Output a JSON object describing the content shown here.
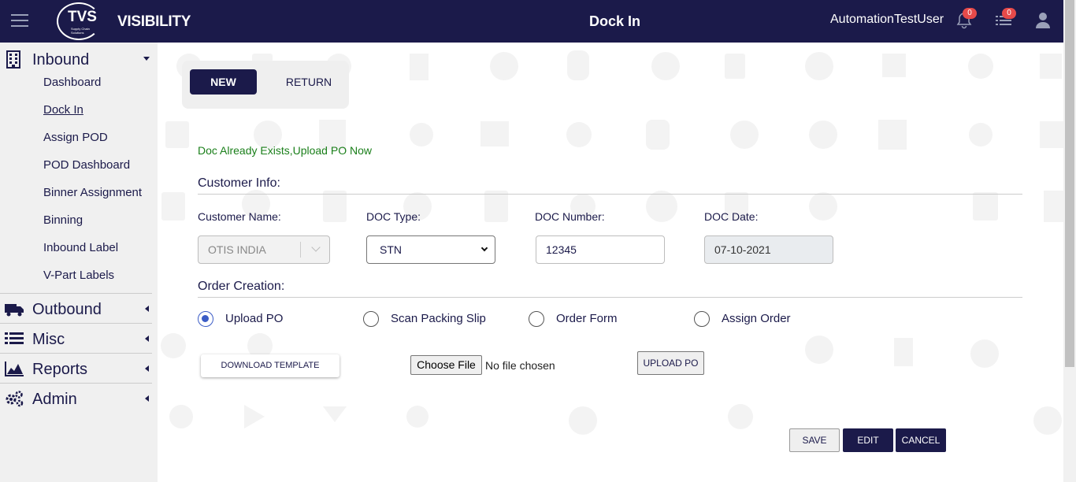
{
  "header": {
    "logo_text": "TVS",
    "logo_sub": "Supply Chain Solutions",
    "app_name": "VISIBILITY",
    "page_title": "Dock In",
    "username": "AutomationTestUser",
    "notifications_count": "0",
    "tasks_count": "0"
  },
  "sidebar": {
    "inbound": {
      "label": "Inbound",
      "items": [
        {
          "label": "Dashboard"
        },
        {
          "label": "Dock In"
        },
        {
          "label": "Assign POD"
        },
        {
          "label": "POD Dashboard"
        },
        {
          "label": "Binner Assignment"
        },
        {
          "label": "Binning"
        },
        {
          "label": "Inbound Label"
        },
        {
          "label": "V-Part Labels"
        }
      ]
    },
    "outbound": {
      "label": "Outbound"
    },
    "misc": {
      "label": "Misc"
    },
    "reports": {
      "label": "Reports"
    },
    "admin": {
      "label": "Admin"
    }
  },
  "main": {
    "toggle": {
      "new_label": "NEW",
      "return_label": "RETURN"
    },
    "message": "Doc Already Exists,Upload PO Now",
    "customer_info_title": "Customer Info:",
    "fields": {
      "customer_name": {
        "label": "Customer Name:",
        "value": "OTIS INDIA"
      },
      "doc_type": {
        "label": "DOC Type:",
        "value": "STN"
      },
      "doc_number": {
        "label": "DOC Number:",
        "value": "12345"
      },
      "doc_date": {
        "label": "DOC Date:",
        "value": "07-10-2021"
      }
    },
    "order_creation_title": "Order Creation:",
    "order_options": [
      {
        "label": "Upload PO",
        "checked": true
      },
      {
        "label": "Scan Packing Slip",
        "checked": false
      },
      {
        "label": "Order Form",
        "checked": false
      },
      {
        "label": "Assign Order",
        "checked": false
      }
    ],
    "download_template_label": "DOWNLOAD TEMPLATE",
    "choose_file_label": "Choose File",
    "no_file_label": "No file chosen",
    "upload_po_label": "UPLOAD PO",
    "save_label": "SAVE",
    "edit_label": "EDIT",
    "cancel_label": "CANCEL"
  },
  "colors": {
    "primary": "#1b1a4a",
    "success_text": "#1a7f1a",
    "radio_accent": "#3b5cc6",
    "badge": "#e64a4a"
  }
}
